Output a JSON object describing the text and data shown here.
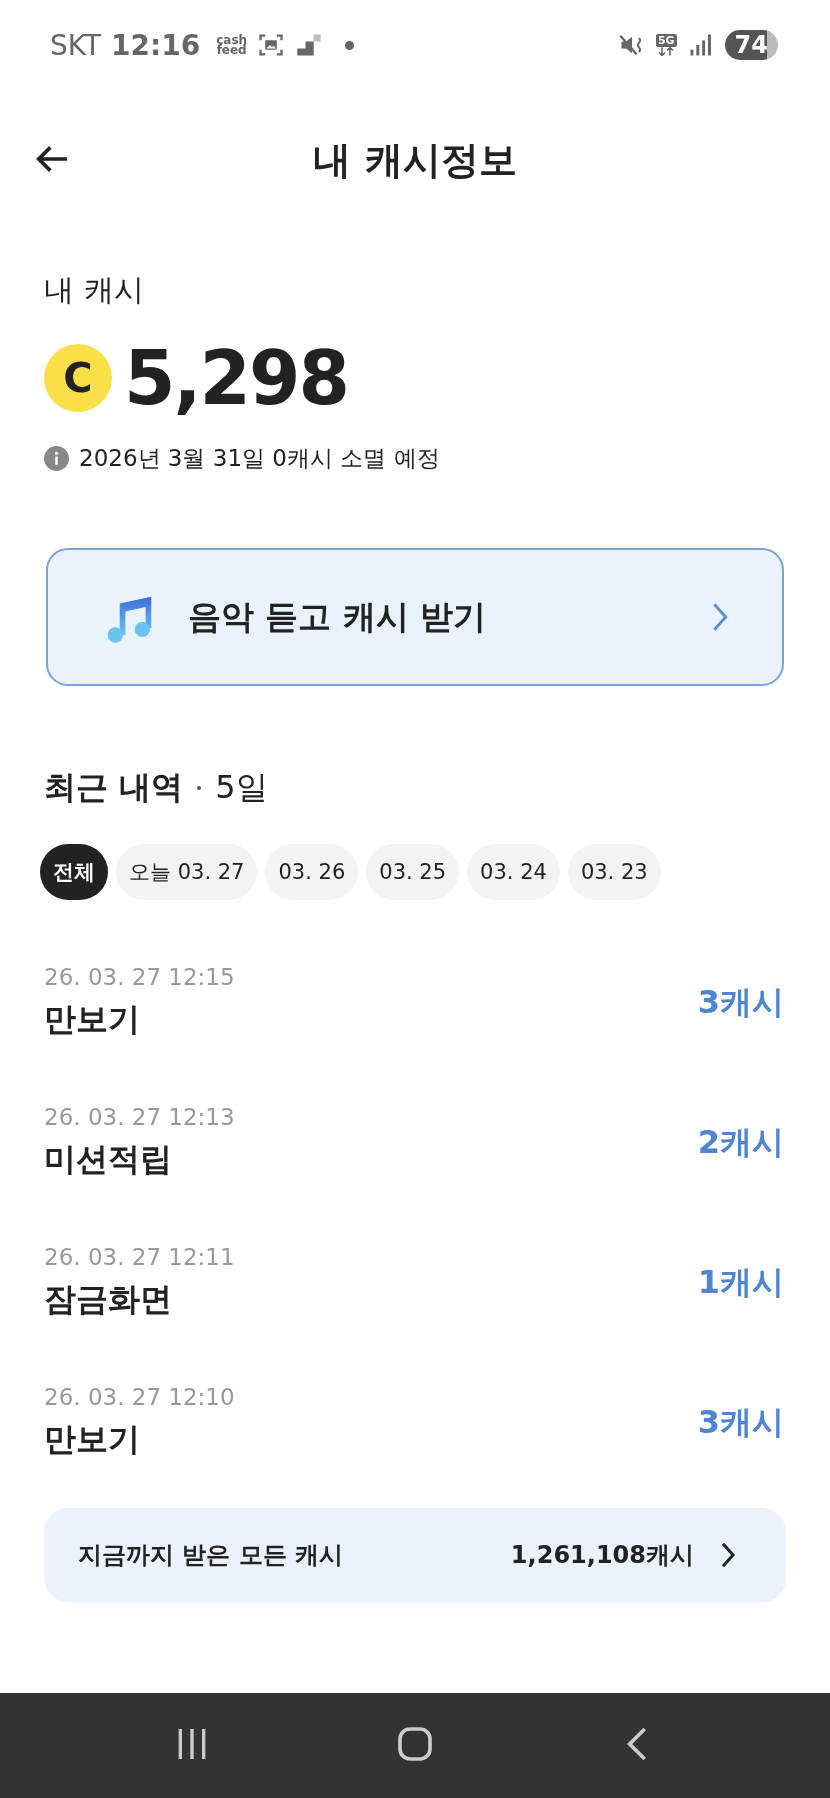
{
  "status_bar": {
    "carrier": "SKT",
    "time": "12:16",
    "app_badge_lines": [
      "cash",
      "feed"
    ],
    "network": "5G",
    "battery": "74"
  },
  "header": {
    "title": "내 캐시정보"
  },
  "balance": {
    "label": "내 캐시",
    "coin": "C",
    "amount": "5,298",
    "notice": "2026년 3월 31일 0캐시 소멸 예정"
  },
  "promo": {
    "label": "음악 듣고 캐시 받기"
  },
  "recent": {
    "title": "최근 내역",
    "days": "5일",
    "filters": [
      {
        "label": "전체",
        "selected": true
      },
      {
        "label": "오늘 03. 27",
        "selected": false
      },
      {
        "label": "03. 26",
        "selected": false
      },
      {
        "label": "03. 25",
        "selected": false
      },
      {
        "label": "03. 24",
        "selected": false
      },
      {
        "label": "03. 23",
        "selected": false
      }
    ],
    "items": [
      {
        "time": "26. 03. 27 12:15",
        "title": "만보기",
        "amount": "3캐시"
      },
      {
        "time": "26. 03. 27 12:13",
        "title": "미션적립",
        "amount": "2캐시"
      },
      {
        "time": "26. 03. 27 12:11",
        "title": "잠금화면",
        "amount": "1캐시"
      },
      {
        "time": "26. 03. 27 12:10",
        "title": "만보기",
        "amount": "3캐시"
      }
    ]
  },
  "total": {
    "label": "지금까지 받은 모든 캐시",
    "amount": "1,261,108캐시"
  }
}
